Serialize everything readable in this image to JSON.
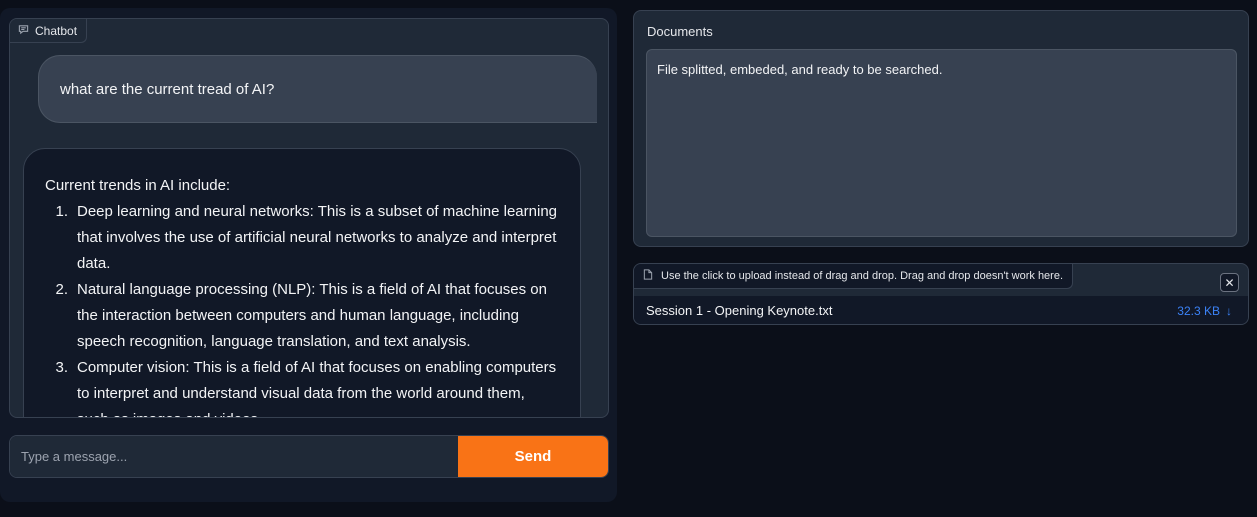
{
  "chatbot": {
    "label": "Chatbot",
    "user_message": "what are the current tread of AI?",
    "bot_intro": "Current trends in AI include:",
    "bot_items": [
      {
        "num": "1.",
        "text": "Deep learning and neural networks: This is a subset of machine learning that involves the use of artificial neural networks to analyze and interpret data."
      },
      {
        "num": "2.",
        "text": "Natural language processing (NLP): This is a field of AI that focuses on the interaction between computers and human language, including speech recognition, language translation, and text analysis."
      },
      {
        "num": "3.",
        "text": "Computer vision: This is a field of AI that focuses on enabling computers to interpret and understand visual data from the world around them, such as images and videos."
      }
    ]
  },
  "composer": {
    "placeholder": "Type a message...",
    "send_label": "Send"
  },
  "documents": {
    "label": "Documents",
    "status_text": "File splitted, embeded, and ready to be searched."
  },
  "upload": {
    "label": "Use the click to upload instead of drag and drop. Drag and drop doesn't work here.",
    "file_name": "Session 1 - Opening Keynote.txt",
    "file_size": "32.3 KB",
    "download_icon": "↓",
    "close_icon": "✕"
  },
  "colors": {
    "accent": "#f97316",
    "link": "#3b82f6",
    "background": "#0b0f19"
  }
}
